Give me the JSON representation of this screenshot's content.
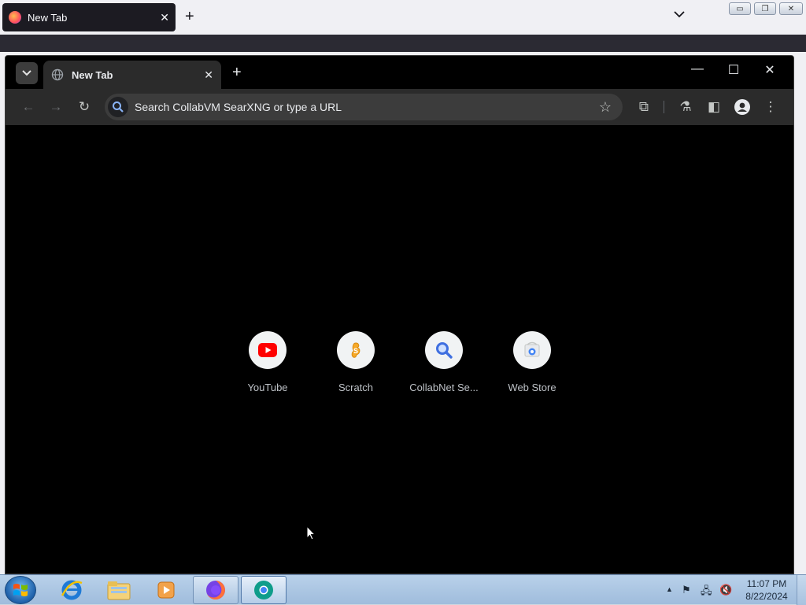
{
  "firefox": {
    "tab_title": "New Tab",
    "tab_close": "✕",
    "new_tab": "+",
    "list_tabs": "⌄",
    "window_controls": {
      "minimize": "▭",
      "restore": "❐",
      "close": "✕"
    }
  },
  "chromium": {
    "tab_search": "⌄",
    "tab_title": "New Tab",
    "tab_close": "✕",
    "new_tab": "+",
    "window_controls": {
      "minimize": "—",
      "maximize": "☐",
      "close": "✕"
    },
    "toolbar": {
      "back": "←",
      "forward": "→",
      "reload": "↻",
      "omnibox_placeholder": "Search CollabVM SearXNG or type a URL",
      "bookmark": "☆",
      "extensions": "⧉",
      "labs": "⚗",
      "side_panel": "◧",
      "menu": "⋮"
    },
    "shortcuts": [
      {
        "label": "YouTube",
        "icon": "youtube-icon"
      },
      {
        "label": "Scratch",
        "icon": "scratch-icon"
      },
      {
        "label": "CollabNet Se...",
        "icon": "magnifier-icon"
      },
      {
        "label": "Web Store",
        "icon": "web-store-icon"
      }
    ]
  },
  "taskbar": {
    "apps": [
      "internet-explorer",
      "windows-explorer",
      "media-player",
      "firefox",
      "chromium"
    ],
    "tray": {
      "expand": "▲",
      "action_center": "⚑",
      "network": "🖧",
      "volume": "🔇"
    },
    "clock": {
      "time": "11:07 PM",
      "date": "8/22/2024"
    }
  },
  "colors": {
    "youtube": "#ff0000",
    "scratch": "#f7a928",
    "search_blue": "#4285f4",
    "taskbar": "#b9d1ea"
  }
}
